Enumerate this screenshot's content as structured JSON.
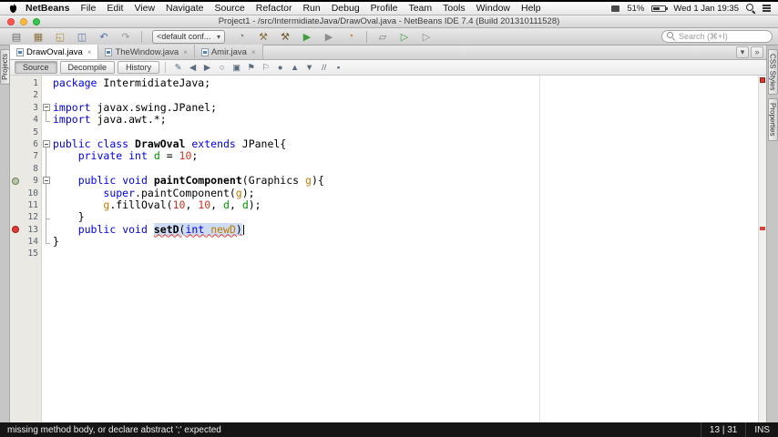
{
  "menubar": {
    "items": [
      "NetBeans",
      "File",
      "Edit",
      "View",
      "Navigate",
      "Source",
      "Refactor",
      "Run",
      "Debug",
      "Profile",
      "Team",
      "Tools",
      "Window",
      "Help"
    ],
    "status": {
      "battery_percent": "51%",
      "clock": "Wed 1 Jan 19:35"
    }
  },
  "titlebar": {
    "title": "Project1 - /src/IntermidiateJava/DrawOval.java - NetBeans IDE 7.4 (Build 201310111528)"
  },
  "toolbar": {
    "config_dropdown": "<default conf...",
    "chevron_down": "▾",
    "search_placeholder": "Search (⌘+I)",
    "left_icons": [
      {
        "name": "new-file-button",
        "glyph": "▤",
        "color": "#6f6f6f"
      },
      {
        "name": "new-project-button",
        "glyph": "▦",
        "color": "#8a7340"
      },
      {
        "name": "open-project-button",
        "glyph": "◱",
        "color": "#b08c3e"
      },
      {
        "name": "save-all-button",
        "glyph": "◫",
        "color": "#5b79a5"
      },
      {
        "name": "undo-button",
        "glyph": "↶",
        "color": "#4a6fa5"
      },
      {
        "name": "redo-button",
        "glyph": "↷",
        "color": "#9a9a9a"
      }
    ],
    "build_icons": [
      {
        "name": "memory-gauge",
        "glyph": "◔",
        "color": "#7a7a7a"
      },
      {
        "name": "build-project-button",
        "glyph": "⚒",
        "color": "#8a6d3b"
      },
      {
        "name": "clean-build-button",
        "glyph": "⚒",
        "color": "#6d5a2e"
      },
      {
        "name": "run-project-button",
        "glyph": "▶",
        "color": "#3f9e3f"
      },
      {
        "name": "debug-project-button",
        "glyph": "▶",
        "color": "#8d8d8d"
      },
      {
        "name": "profile-project-button",
        "glyph": "◔",
        "color": "#cf7f2e"
      }
    ],
    "extra_icons": [
      {
        "name": "create-group-button",
        "glyph": "▱",
        "color": "#7a7a7a"
      },
      {
        "name": "run-file-button",
        "glyph": "▷",
        "color": "#3f9e3f"
      },
      {
        "name": "debug-file-button",
        "glyph": "▷",
        "color": "#8d8d8d"
      }
    ]
  },
  "icons": {
    "close_tab": "×"
  },
  "tabs": [
    {
      "label": "DrawOval.java",
      "active": true
    },
    {
      "label": "TheWindow.java",
      "active": false
    },
    {
      "label": "Amir.java",
      "active": false
    }
  ],
  "tabstrip_buttons": [
    {
      "name": "tab-list-button",
      "glyph": "▾"
    },
    {
      "name": "tab-maximize-button",
      "glyph": "»"
    }
  ],
  "editor_toolbar": {
    "views": [
      {
        "label": "Source",
        "active": true
      },
      {
        "label": "Decompile",
        "active": false
      },
      {
        "label": "History",
        "active": false
      }
    ],
    "icons": [
      {
        "name": "last-edit-icon",
        "glyph": "✎"
      },
      {
        "name": "back-icon",
        "glyph": "◀"
      },
      {
        "name": "forward-icon",
        "glyph": "▶"
      },
      {
        "name": "find-selection-icon",
        "glyph": "○"
      },
      {
        "name": "toggle-highlight-icon",
        "glyph": "▣"
      },
      {
        "name": "previous-bookmark-icon",
        "glyph": "⚑"
      },
      {
        "name": "next-bookmark-icon",
        "glyph": "⚐"
      },
      {
        "name": "toggle-bookmark-icon",
        "glyph": "●"
      },
      {
        "name": "previous-occurrence-icon",
        "glyph": "▲"
      },
      {
        "name": "next-occurrence-icon",
        "glyph": "▼"
      },
      {
        "name": "comment-icon",
        "glyph": "//"
      },
      {
        "name": "macro-icon",
        "glyph": "▪"
      }
    ]
  },
  "docks": {
    "left": [
      "Projects"
    ],
    "right": [
      "CSS Styles",
      "Properties"
    ]
  },
  "editor": {
    "lines": [
      {
        "num": 1,
        "tokens": [
          {
            "c": "k",
            "t": "package"
          },
          {
            "c": "t",
            "t": " IntermidiateJava;"
          }
        ]
      },
      {
        "num": 2,
        "tokens": []
      },
      {
        "num": 3,
        "tokens": [
          {
            "c": "k",
            "t": "import"
          },
          {
            "c": "t",
            "t": " javax.swing.JPanel;"
          }
        ]
      },
      {
        "num": 4,
        "tokens": [
          {
            "c": "k",
            "t": "import"
          },
          {
            "c": "t",
            "t": " java.awt.*;"
          }
        ]
      },
      {
        "num": 5,
        "tokens": []
      },
      {
        "num": 6,
        "tokens": [
          {
            "c": "k",
            "t": "public"
          },
          {
            "c": "t",
            "t": " "
          },
          {
            "c": "k",
            "t": "class"
          },
          {
            "c": "t",
            "t": " "
          },
          {
            "c": "dcl",
            "t": "DrawOval"
          },
          {
            "c": "t",
            "t": " "
          },
          {
            "c": "k",
            "t": "extends"
          },
          {
            "c": "t",
            "t": " JPanel{"
          }
        ]
      },
      {
        "num": 7,
        "tokens": [
          {
            "c": "t",
            "t": "    "
          },
          {
            "c": "k",
            "t": "private"
          },
          {
            "c": "t",
            "t": " "
          },
          {
            "c": "k",
            "t": "int"
          },
          {
            "c": "t",
            "t": " "
          },
          {
            "c": "fl",
            "t": "d"
          },
          {
            "c": "t",
            "t": " = "
          },
          {
            "c": "n",
            "t": "10"
          },
          {
            "c": "t",
            "t": ";"
          }
        ]
      },
      {
        "num": 8,
        "tokens": []
      },
      {
        "num": 9,
        "tokens": [
          {
            "c": "t",
            "t": "    "
          },
          {
            "c": "k",
            "t": "public"
          },
          {
            "c": "t",
            "t": " "
          },
          {
            "c": "k",
            "t": "void"
          },
          {
            "c": "t",
            "t": " "
          },
          {
            "c": "dcl",
            "t": "paintComponent"
          },
          {
            "c": "t",
            "t": "(Graphics "
          },
          {
            "c": "pr",
            "t": "g"
          },
          {
            "c": "t",
            "t": "){"
          }
        ]
      },
      {
        "num": 10,
        "tokens": [
          {
            "c": "t",
            "t": "        "
          },
          {
            "c": "k",
            "t": "super"
          },
          {
            "c": "t",
            "t": ".paintComponent("
          },
          {
            "c": "pr",
            "t": "g"
          },
          {
            "c": "t",
            "t": ");"
          }
        ]
      },
      {
        "num": 11,
        "tokens": [
          {
            "c": "t",
            "t": "        "
          },
          {
            "c": "pr",
            "t": "g"
          },
          {
            "c": "t",
            "t": ".fillOval("
          },
          {
            "c": "n",
            "t": "10"
          },
          {
            "c": "t",
            "t": ", "
          },
          {
            "c": "n",
            "t": "10"
          },
          {
            "c": "t",
            "t": ", "
          },
          {
            "c": "fl",
            "t": "d"
          },
          {
            "c": "t",
            "t": ", "
          },
          {
            "c": "fl",
            "t": "d"
          },
          {
            "c": "t",
            "t": ");"
          }
        ]
      },
      {
        "num": 12,
        "tokens": [
          {
            "c": "t",
            "t": "    }"
          }
        ]
      },
      {
        "num": 13,
        "tokens": [
          {
            "c": "t",
            "t": "    "
          },
          {
            "c": "k",
            "t": "public"
          },
          {
            "c": "t",
            "t": " "
          },
          {
            "c": "k",
            "t": "void"
          },
          {
            "c": "t",
            "t": " "
          },
          {
            "c": "dcl sel err",
            "t": "setD"
          },
          {
            "c": "t sel err",
            "t": "("
          },
          {
            "c": "k sel err",
            "t": "int"
          },
          {
            "c": "t sel err",
            "t": " "
          },
          {
            "c": "pr sel err",
            "t": "newD"
          },
          {
            "c": "t sel err",
            "t": ")"
          },
          {
            "c": "caret",
            "t": ""
          }
        ]
      },
      {
        "num": 14,
        "tokens": [
          {
            "c": "t",
            "t": "}"
          }
        ]
      },
      {
        "num": 15,
        "tokens": []
      }
    ],
    "annotations": {
      "9": "override",
      "13": "error"
    },
    "folds": [
      {
        "from": 3,
        "to": 4
      },
      {
        "from": 6,
        "to": 14
      },
      {
        "from": 9,
        "to": 12
      }
    ],
    "error_lines": [
      13
    ]
  },
  "statusbar": {
    "message": "missing method body, or declare abstract ';' expected",
    "caret_position": "13 | 31",
    "mode": "INS"
  },
  "colors": {
    "keyword": "#0000e6",
    "number": "#cc3322",
    "field": "#009300",
    "param": "#c07b00",
    "selection": "#cddcf2",
    "error_underline": "#e23b2e"
  }
}
